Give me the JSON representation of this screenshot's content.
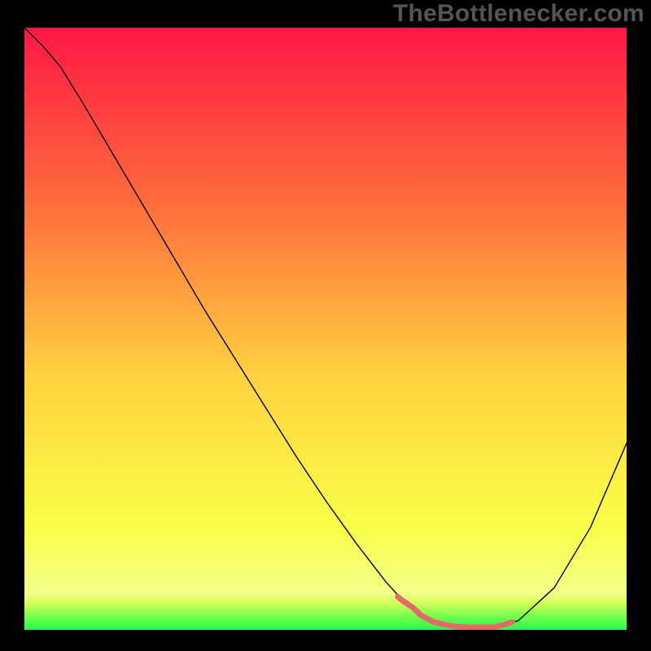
{
  "watermark": {
    "text": "TheBottlenecker.com"
  },
  "chart_data": {
    "type": "line",
    "title": "",
    "xlabel": "",
    "ylabel": "",
    "xlim": [
      0,
      100
    ],
    "ylim": [
      0,
      100
    ],
    "axes_visible": false,
    "background_gradient": {
      "top": "#ff1744",
      "upper_mid": "#ff6f3c",
      "mid": "#ffd23f",
      "lower_mid": "#f8ff3d",
      "bottom_strip": "#2aff4d"
    },
    "series": [
      {
        "name": "curve",
        "color": "#000000",
        "stroke_width": 1.4,
        "x": [
          0,
          3,
          6,
          10,
          15,
          20,
          25,
          30,
          35,
          40,
          45,
          50,
          55,
          60,
          63,
          66,
          70,
          74,
          78,
          82,
          88,
          94,
          100
        ],
        "y": [
          100,
          97,
          93.5,
          87,
          78.5,
          70,
          61.5,
          53,
          45,
          37,
          29,
          21.5,
          14.5,
          8,
          4.7,
          2.3,
          0.8,
          0.4,
          0.45,
          1.5,
          7,
          17,
          31
        ]
      },
      {
        "name": "flat-bottom-highlight",
        "role": "selection-marker",
        "color": "#e46a68",
        "stroke_width": 7,
        "x": [
          62,
          63,
          64.5,
          66,
          68,
          70,
          72,
          74,
          76,
          78,
          79.5,
          81
        ],
        "y": [
          5.5,
          4.7,
          3.7,
          2.3,
          1.3,
          0.8,
          0.5,
          0.4,
          0.4,
          0.45,
          0.8,
          1.3
        ]
      }
    ]
  }
}
